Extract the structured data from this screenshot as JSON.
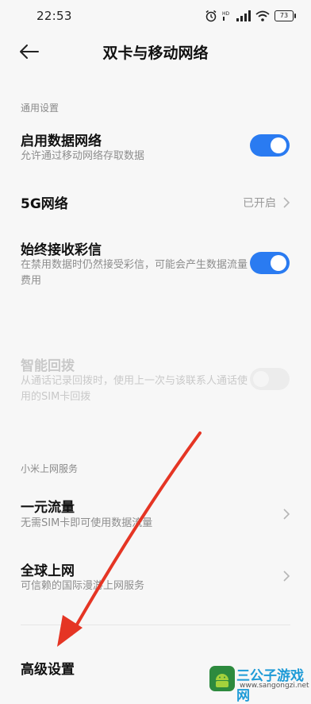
{
  "status_bar": {
    "time": "22:53",
    "battery": "73",
    "icons": [
      "alarm-icon",
      "hd-icon",
      "signal-icon",
      "wifi-icon",
      "battery-icon"
    ]
  },
  "header": {
    "back_icon": "back-arrow-icon",
    "title": "双卡与移动网络"
  },
  "sections": {
    "general": "通用设置",
    "xiaomi": "小米上网服务"
  },
  "rows": {
    "mobile_data": {
      "title": "启用数据网络",
      "subtitle": "允许通过移动网络存取数据",
      "enabled": true
    },
    "five_g": {
      "title": "5G网络",
      "value": "已开启"
    },
    "mms": {
      "title": "始终接收彩信",
      "subtitle": "在禁用数据时仍然接受彩信，可能会产生数据流量费用",
      "enabled": true
    },
    "smart_redial": {
      "title": "智能回拨",
      "subtitle": "从通话记录回拨时，使用上一次与该联系人通话使用的SIM卡回拨",
      "enabled": false,
      "disabled": true
    },
    "one_yuan": {
      "title": "一元流量",
      "subtitle": "无需SIM卡即可使用数据流量"
    },
    "global": {
      "title": "全球上网",
      "subtitle": "可信赖的国际漫游上网服务"
    },
    "advanced": {
      "title": "高级设置"
    }
  },
  "watermark": {
    "name": "三公子游戏网",
    "url": "www.sangongzi.net"
  },
  "colors": {
    "accent": "#2a7bf1",
    "annotation_arrow": "#e53524",
    "background": "#f7f7f7"
  }
}
